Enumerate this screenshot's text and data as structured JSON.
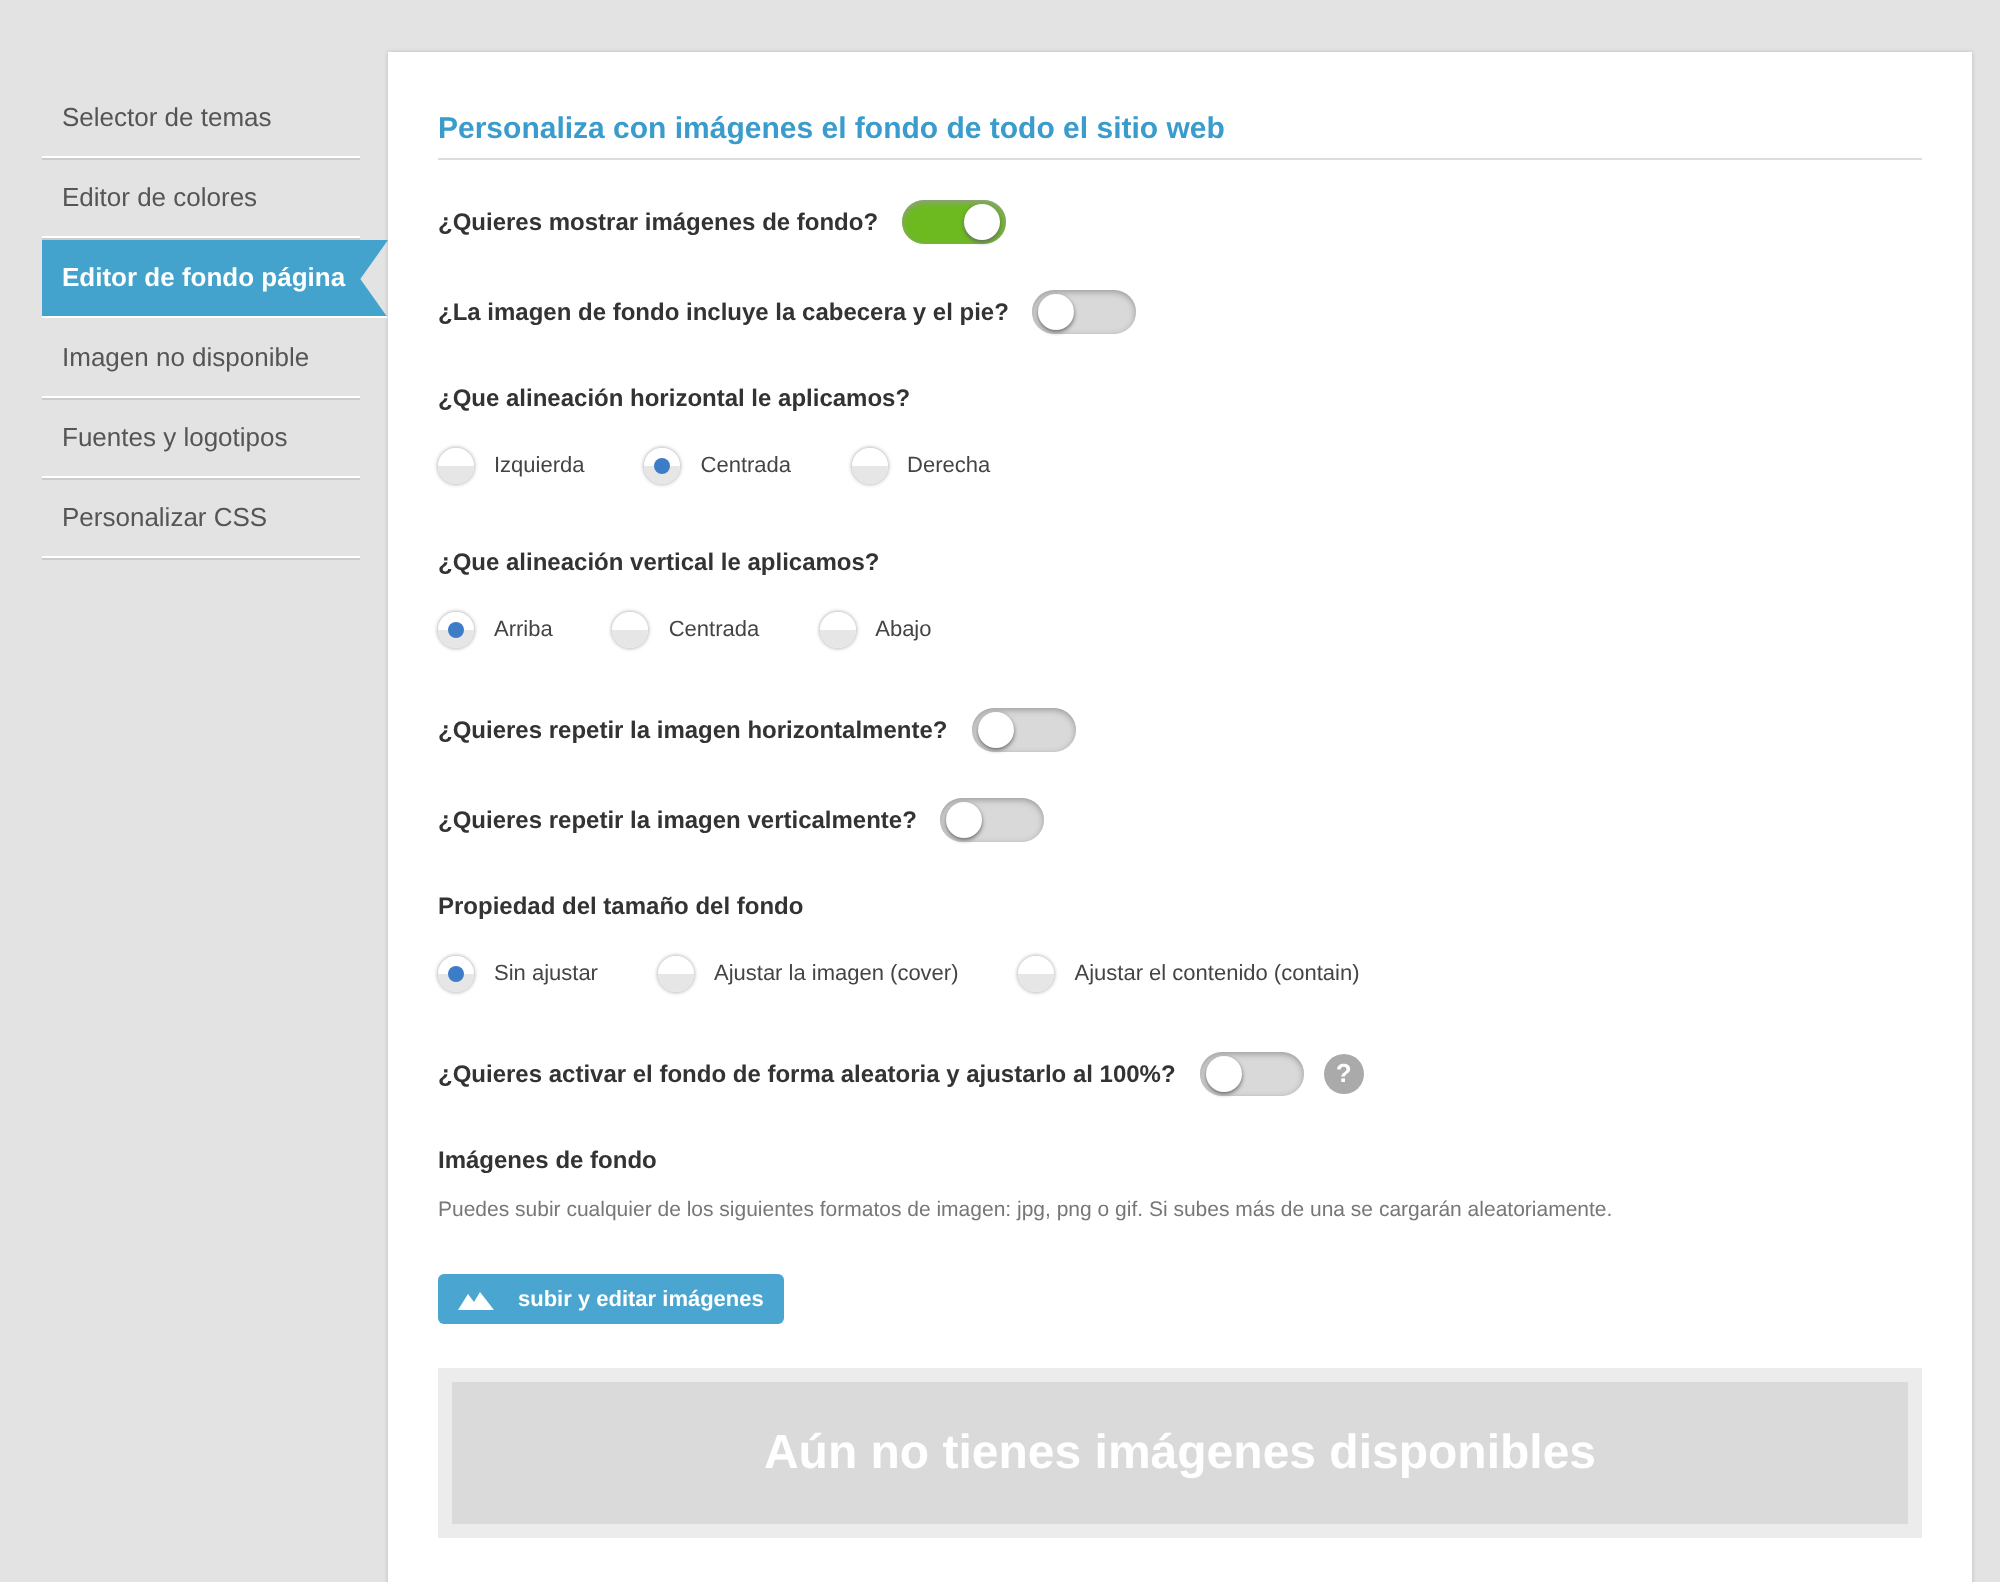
{
  "sidebar": {
    "items": [
      {
        "label": "Selector de temas",
        "selected": false
      },
      {
        "label": "Editor de colores",
        "selected": false
      },
      {
        "label": "Editor de fondo página",
        "selected": true
      },
      {
        "label": "Imagen no disponible",
        "selected": false
      },
      {
        "label": "Fuentes y logotipos",
        "selected": false
      },
      {
        "label": "Personalizar CSS",
        "selected": false
      }
    ]
  },
  "panel": {
    "title": "Personaliza con imágenes el fondo de todo el sitio web",
    "fields": [
      {
        "kind": "toggle",
        "label": "¿Quieres mostrar imágenes de fondo?",
        "on": true
      },
      {
        "kind": "toggle",
        "label": "¿La imagen de fondo incluye la cabecera y el pie?",
        "on": false
      },
      {
        "kind": "radio",
        "label": "¿Que alineación horizontal le aplicamos?",
        "options": [
          {
            "label": "Izquierda",
            "selected": false
          },
          {
            "label": "Centrada",
            "selected": true
          },
          {
            "label": "Derecha",
            "selected": false
          }
        ]
      },
      {
        "kind": "radio",
        "label": "¿Que alineación vertical le aplicamos?",
        "options": [
          {
            "label": "Arriba",
            "selected": true
          },
          {
            "label": "Centrada",
            "selected": false
          },
          {
            "label": "Abajo",
            "selected": false
          }
        ]
      },
      {
        "kind": "toggle",
        "label": "¿Quieres repetir la imagen horizontalmente?",
        "on": false
      },
      {
        "kind": "toggle",
        "label": "¿Quieres repetir la imagen verticalmente?",
        "on": false
      },
      {
        "kind": "radio",
        "label": "Propiedad del tamaño del fondo",
        "options": [
          {
            "label": "Sin ajustar",
            "selected": true
          },
          {
            "label": "Ajustar la imagen (cover)",
            "selected": false
          },
          {
            "label": "Ajustar el contenido (contain)",
            "selected": false
          }
        ]
      },
      {
        "kind": "toggle",
        "label": "¿Quieres activar el fondo de forma aleatoria y ajustarlo al 100%?",
        "on": false,
        "help": "?"
      }
    ],
    "images": {
      "heading": "Imágenes de fondo",
      "note": "Puedes subir cualquier de los siguientes formatos de imagen: jpg, png o gif. Si subes más de una se cargarán aleatoriamente.",
      "upload_button": "subir y editar imágenes",
      "empty_message": "Aún no tienes imágenes disponibles"
    }
  }
}
